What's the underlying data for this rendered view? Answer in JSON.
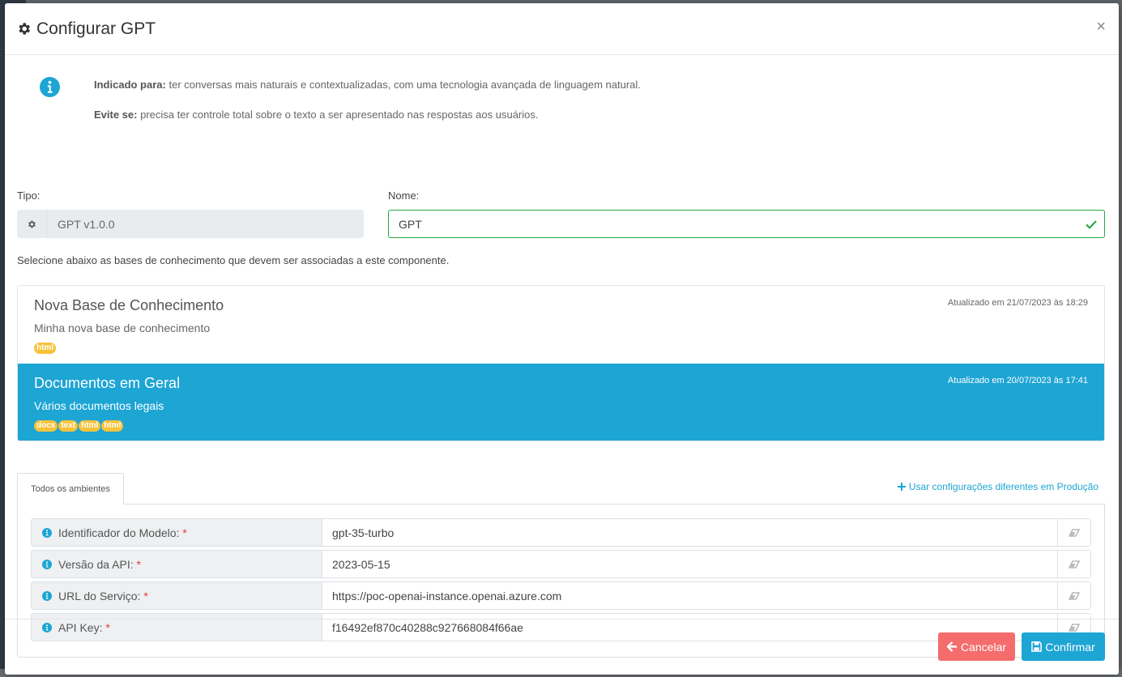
{
  "dialog": {
    "title": "Configurar GPT",
    "close_label": "×"
  },
  "info": {
    "indicated_label": "Indicado para:",
    "indicated_text": " ter conversas mais naturais e contextualizadas, com uma tecnologia avançada de linguagem natural.",
    "avoid_label": "Evite se:",
    "avoid_text": " precisa ter controle total sobre o texto a ser apresentado nas respostas aos usuários."
  },
  "form": {
    "tipo_label": "Tipo:",
    "tipo_value": "GPT v1.0.0",
    "nome_label": "Nome:",
    "nome_value": "GPT"
  },
  "knowledge": {
    "hint": "Selecione abaixo as bases de conhecimento que devem ser associadas a este componente.",
    "items": [
      {
        "title": "Nova Base de Conhecimento",
        "description": "Minha nova base de conhecimento",
        "updated": "Atualizado em 21/07/2023 às 18:29",
        "tags": [
          "html"
        ]
      },
      {
        "title": "Documentos em Geral",
        "description": "Vários documentos legais",
        "updated": "Atualizado em 20/07/2023 às 17:41",
        "tags": [
          "docx",
          "text",
          "html",
          "html"
        ]
      }
    ]
  },
  "tabs": {
    "all_envs": "Todos os ambientes",
    "prod_link": "Usar configurações diferentes em Produção"
  },
  "config": {
    "required_mark": "*",
    "rows": [
      {
        "label": "Identificador do Modelo:",
        "value": "gpt-35-turbo"
      },
      {
        "label": "Versão da API:",
        "value": "2023-05-15"
      },
      {
        "label": "URL do Serviço:",
        "value": "https://poc-openai-instance.openai.azure.com"
      },
      {
        "label": "API Key:",
        "value": "f16492ef870c40288c927668084f66ae"
      }
    ]
  },
  "footer": {
    "cancel_label": "Cancelar",
    "confirm_label": "Confirmar"
  },
  "colors": {
    "accent": "#1da5d4",
    "cancel": "#f56c6c",
    "success": "#28a745",
    "tag": "#f7c23b"
  },
  "icons": {
    "title": "gear-icon",
    "info": "info-circle-icon",
    "tipo": "gear-icon",
    "valid": "check-icon",
    "prod_link": "plus-icon",
    "row_info": "info-circle-icon",
    "row_clear": "eraser-icon",
    "cancel": "arrow-left-icon",
    "confirm": "save-icon"
  }
}
